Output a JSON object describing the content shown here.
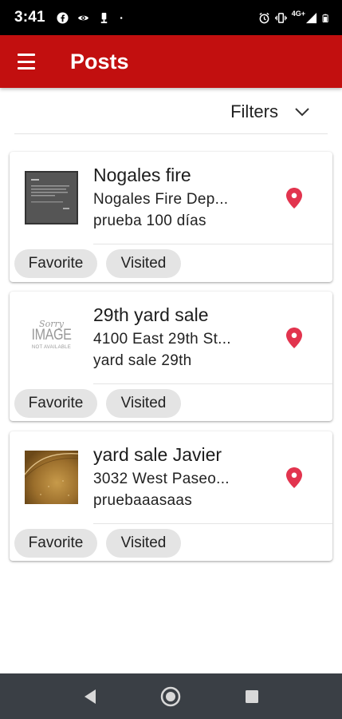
{
  "status_bar": {
    "time": "3:41",
    "left_icons": [
      "facebook-icon",
      "eye-icon",
      "upload-icon",
      "dot-icon"
    ],
    "right_icons": [
      "alarm-icon",
      "vibrate-icon",
      "signal-4g-icon",
      "battery-icon"
    ],
    "network_label": "4G+"
  },
  "app_bar": {
    "menu_icon": "menu-icon",
    "title": "Posts",
    "color": "#c20f0f"
  },
  "filters": {
    "label": "Filters",
    "icon": "chevron-down-icon"
  },
  "posts": [
    {
      "title": "Nogales fire",
      "address": "Nogales Fire Dep...",
      "description": "prueba 100 días",
      "thumbnail": "dark-screenshot-thumbnail",
      "favorite_label": "Favorite",
      "visited_label": "Visited"
    },
    {
      "title": "29th yard sale",
      "address": "4100 East 29th St...",
      "description": "yard sale 29th",
      "thumbnail": "image-not-available-thumbnail",
      "thumbnail_text": {
        "top": "Sorry",
        "main": "IMAGE",
        "bottom": "NOT AVAILABLE"
      },
      "favorite_label": "Favorite",
      "visited_label": "Visited"
    },
    {
      "title": "yard sale Javier",
      "address": "3032 West Paseo...",
      "description": "pruebaaasaas",
      "thumbnail": "golden-textured-thumbnail",
      "favorite_label": "Favorite",
      "visited_label": "Visited"
    }
  ],
  "pin_color": "#e2344e",
  "nav_bar": {
    "buttons": [
      "back-icon",
      "home-icon",
      "recents-icon"
    ]
  }
}
